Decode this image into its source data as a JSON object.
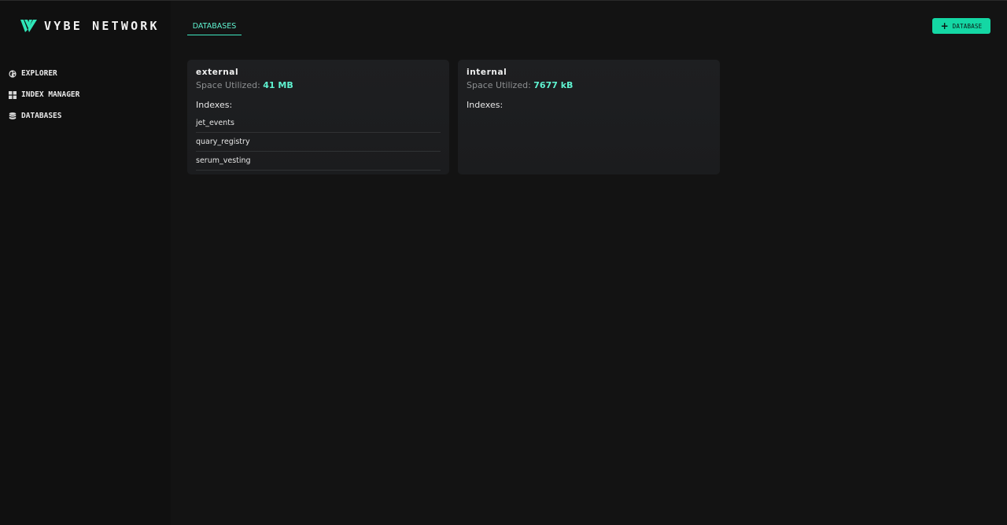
{
  "sidebar": {
    "logo_text": "VYBE NETWORK",
    "nav": [
      {
        "icon": "globe-icon",
        "label": "EXPLORER"
      },
      {
        "icon": "grid-icon",
        "label": "INDEX MANAGER"
      },
      {
        "icon": "database-icon",
        "label": "DATABASES"
      }
    ]
  },
  "header": {
    "tab_label": "DATABASES",
    "add_button_label": "DATABASE",
    "add_button_icon": "plus-icon"
  },
  "databases": [
    {
      "name": "external",
      "space_label": "Space Utilized:",
      "space_value": "41 MB",
      "indexes_label": "Indexes:",
      "indexes": [
        "jet_events",
        "quary_registry",
        "serum_vesting"
      ]
    },
    {
      "name": "internal",
      "space_label": "Space Utilized:",
      "space_value": "7677 kB",
      "indexes_label": "Indexes:",
      "indexes": []
    }
  ],
  "colors": {
    "accent": "#14d7a4",
    "accent_text": "#5ff2d0",
    "background": "#131313",
    "sidebar": "#101010",
    "card": "#1e1f21"
  }
}
